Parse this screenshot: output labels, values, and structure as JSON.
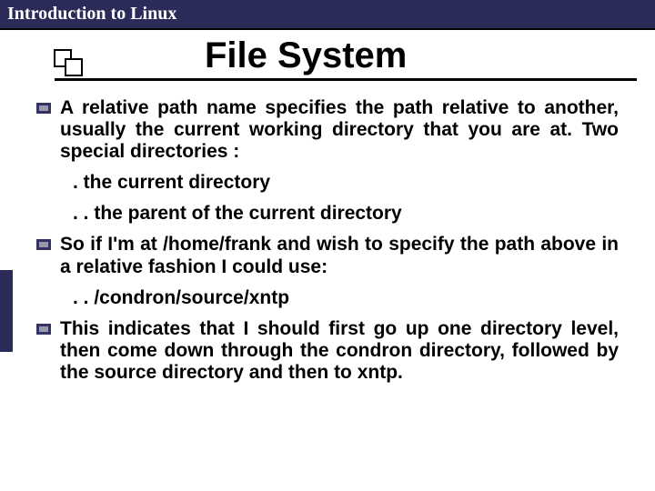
{
  "header": {
    "title": "Introduction to Linux"
  },
  "slide": {
    "title": "File System",
    "bullets": [
      {
        "text": "A relative path name specifies the path relative to another, usually the current working directory that you are at. Two special directories :",
        "subs": [
          ". the current directory",
          ". . the parent of the current directory"
        ]
      },
      {
        "text": "So if I'm at /home/frank and wish to specify the path above in a relative fashion I could use:",
        "subs": [
          ". . /condron/source/xntp"
        ]
      },
      {
        "text": "This indicates that I should first go up one directory level, then come down through the condron directory, followed by the source directory and then to xntp.",
        "subs": []
      }
    ]
  }
}
